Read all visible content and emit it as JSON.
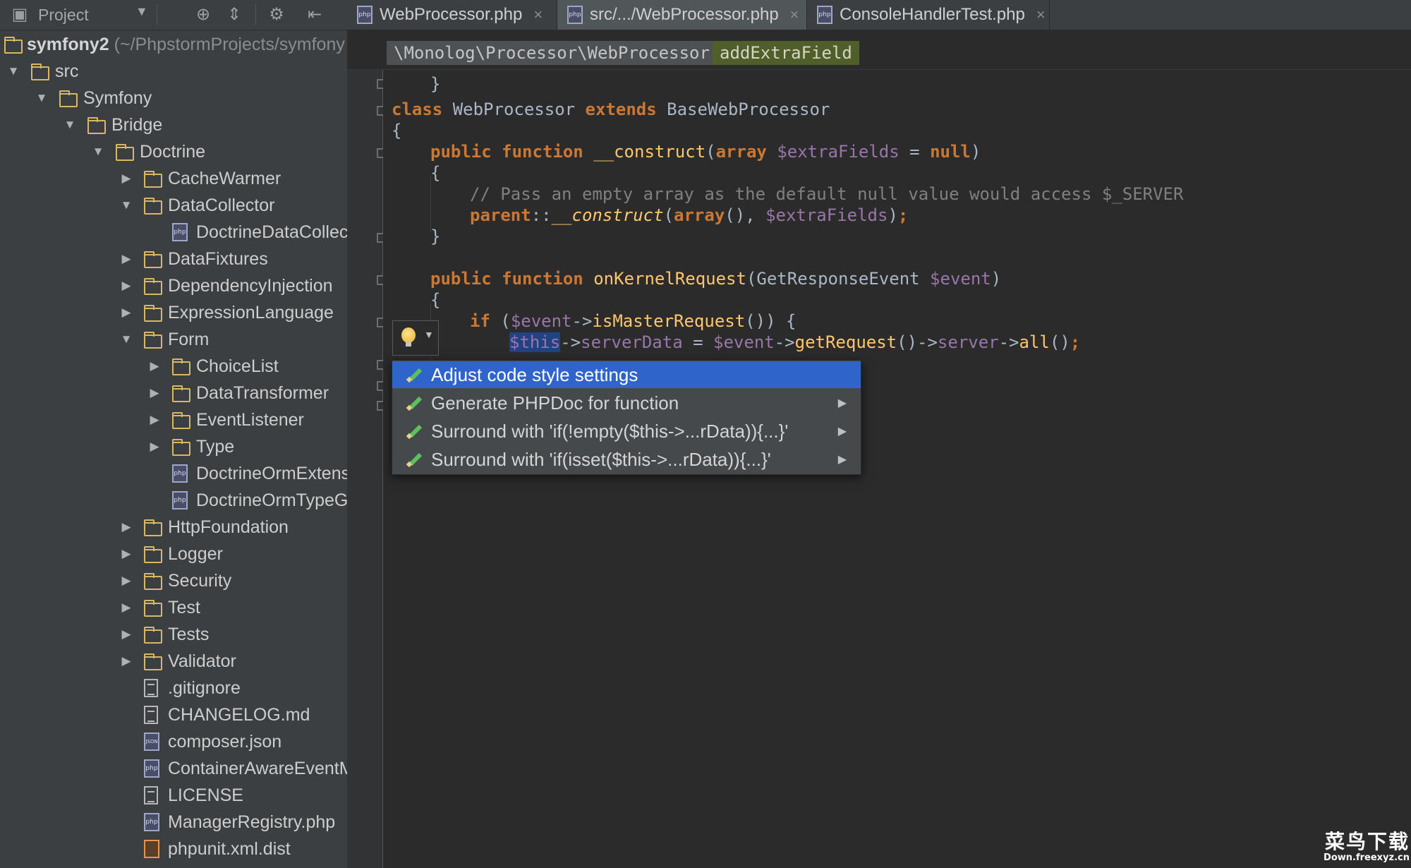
{
  "project_panel": {
    "title": "Project",
    "dropdown": "▼",
    "root_label": "symfony2",
    "root_path": " (~/PhpstormProjects/symfony",
    "tree": [
      {
        "label": "src",
        "type": "folder",
        "expanded": true
      },
      {
        "label": "Symfony",
        "type": "folder",
        "expanded": true
      },
      {
        "label": "Bridge",
        "type": "folder",
        "expanded": true
      },
      {
        "label": "Doctrine",
        "type": "folder",
        "expanded": true
      },
      {
        "label": "CacheWarmer",
        "type": "folder",
        "expanded": false
      },
      {
        "label": "DataCollector",
        "type": "folder",
        "expanded": true
      },
      {
        "label": "DoctrineDataCollector.php",
        "type": "php"
      },
      {
        "label": "DataFixtures",
        "type": "folder",
        "expanded": false
      },
      {
        "label": "DependencyInjection",
        "type": "folder",
        "expanded": false
      },
      {
        "label": "ExpressionLanguage",
        "type": "folder",
        "expanded": false
      },
      {
        "label": "Form",
        "type": "folder",
        "expanded": true
      },
      {
        "label": "ChoiceList",
        "type": "folder",
        "expanded": false
      },
      {
        "label": "DataTransformer",
        "type": "folder",
        "expanded": false
      },
      {
        "label": "EventListener",
        "type": "folder",
        "expanded": false
      },
      {
        "label": "Type",
        "type": "folder",
        "expanded": false
      },
      {
        "label": "DoctrineOrmExtension.php",
        "type": "php"
      },
      {
        "label": "DoctrineOrmTypeGuesser.php",
        "type": "php"
      },
      {
        "label": "HttpFoundation",
        "type": "folder",
        "expanded": false
      },
      {
        "label": "Logger",
        "type": "folder",
        "expanded": false
      },
      {
        "label": "Security",
        "type": "folder",
        "expanded": false
      },
      {
        "label": "Test",
        "type": "folder",
        "expanded": false
      },
      {
        "label": "Tests",
        "type": "folder",
        "expanded": false
      },
      {
        "label": "Validator",
        "type": "folder",
        "expanded": false
      },
      {
        "label": ".gitignore",
        "type": "text"
      },
      {
        "label": "CHANGELOG.md",
        "type": "text"
      },
      {
        "label": "composer.json",
        "type": "json"
      },
      {
        "label": "ContainerAwareEventManager.php",
        "type": "php"
      },
      {
        "label": "LICENSE",
        "type": "text"
      },
      {
        "label": "ManagerRegistry.php",
        "type": "php"
      },
      {
        "label": "phpunit.xml.dist",
        "type": "xml"
      }
    ]
  },
  "tabs": [
    {
      "label": "WebProcessor.php",
      "active": false
    },
    {
      "label": "src/.../WebProcessor.php",
      "active": true
    },
    {
      "label": "ConsoleHandlerTest.php",
      "active": false
    }
  ],
  "tab_close": "×",
  "file_icon_text": "php",
  "json_icon_text": "JSON",
  "breadcrumb": {
    "class_path": "\\Monolog\\Processor\\WebProcessor",
    "method": "addExtraField"
  },
  "code": {
    "line_brace_close": "}",
    "line_class": "class WebProcessor extends BaseWebProcessor",
    "line_brace_open": "{",
    "line_constructor": "public function __construct(array $extraFields = null)",
    "line_comment": "// Pass an empty array as the default null value would access $_SERVER",
    "line_parent": "parent::__construct(array(), $extraFields);",
    "line_onkernel": "public function onKernelRequest(GetResponseEvent $event)",
    "line_if": "if ($event->isMasterRequest()) {",
    "line_server": "$this->serverData = $event->getRequest()->server->all();"
  },
  "intention_popup": {
    "items": [
      {
        "label": "Adjust code style settings",
        "selected": true,
        "submenu": false
      },
      {
        "label": "Generate PHPDoc for function",
        "selected": false,
        "submenu": true
      },
      {
        "label": "Surround with 'if(!empty($this->...rData)){...}'",
        "selected": false,
        "submenu": true
      },
      {
        "label": "Surround with 'if(isset($this->...rData)){...}'",
        "selected": false,
        "submenu": true
      }
    ]
  },
  "watermark": {
    "main": "菜鸟下载",
    "url": "Down.freexyz.cn"
  },
  "colors": {
    "background": "#2b2b2b",
    "panel": "#3c3f41",
    "keyword": "#cc7832",
    "function": "#ffc66d",
    "variable": "#9876aa",
    "selection": "#2f65ca"
  }
}
